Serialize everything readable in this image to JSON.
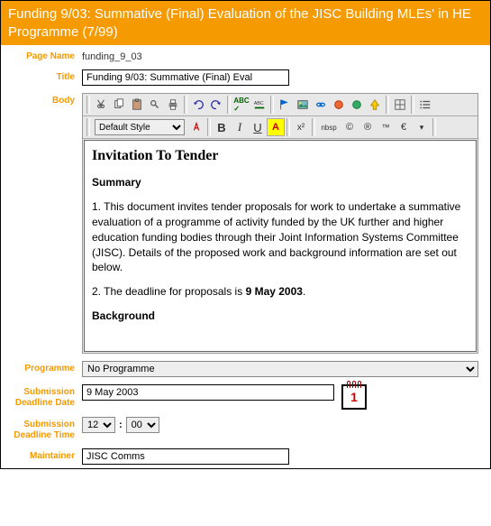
{
  "header": {
    "title": "Funding 9/03: Summative (Final) Evaluation of the JISC Building MLEs' in HE Programme (7/99)"
  },
  "fields": {
    "page_name_label": "Page Name",
    "page_name_value": "funding_9_03",
    "title_label": "Title",
    "title_value": "Funding 9/03: Summative (Final) Eval",
    "body_label": "Body",
    "programme_label": "Programme",
    "programme_value": "No Programme",
    "deadline_date_label": "Submission Deadline Date",
    "deadline_date_value": "9 May 2003",
    "deadline_time_label": "Submission Deadline Time",
    "time_hour": "12",
    "time_min": "00",
    "time_sep": ":",
    "maintainer_label": "Maintainer",
    "maintainer_value": "JISC Comms"
  },
  "editor": {
    "style_select": "Default Style",
    "bold": "B",
    "italic": "I",
    "underline": "U",
    "super": "x²",
    "nbsp": "nbsp",
    "copy_sym": "©",
    "reg_sym": "®",
    "tm_sym": "™",
    "euro_sym": "€"
  },
  "body_content": {
    "h1": "Invitation To Tender",
    "sub1": "Summary",
    "p1": "1. This document invites tender proposals for work to undertake a summative evaluation of a programme of activity funded by the UK further and higher education funding bodies through their Joint Information Systems Committee (JISC). Details of the proposed work and background information are set out below.",
    "p2_a": "2. The deadline for proposals is ",
    "p2_b": "9 May 2003",
    "p2_c": ".",
    "sub2": "Background"
  }
}
